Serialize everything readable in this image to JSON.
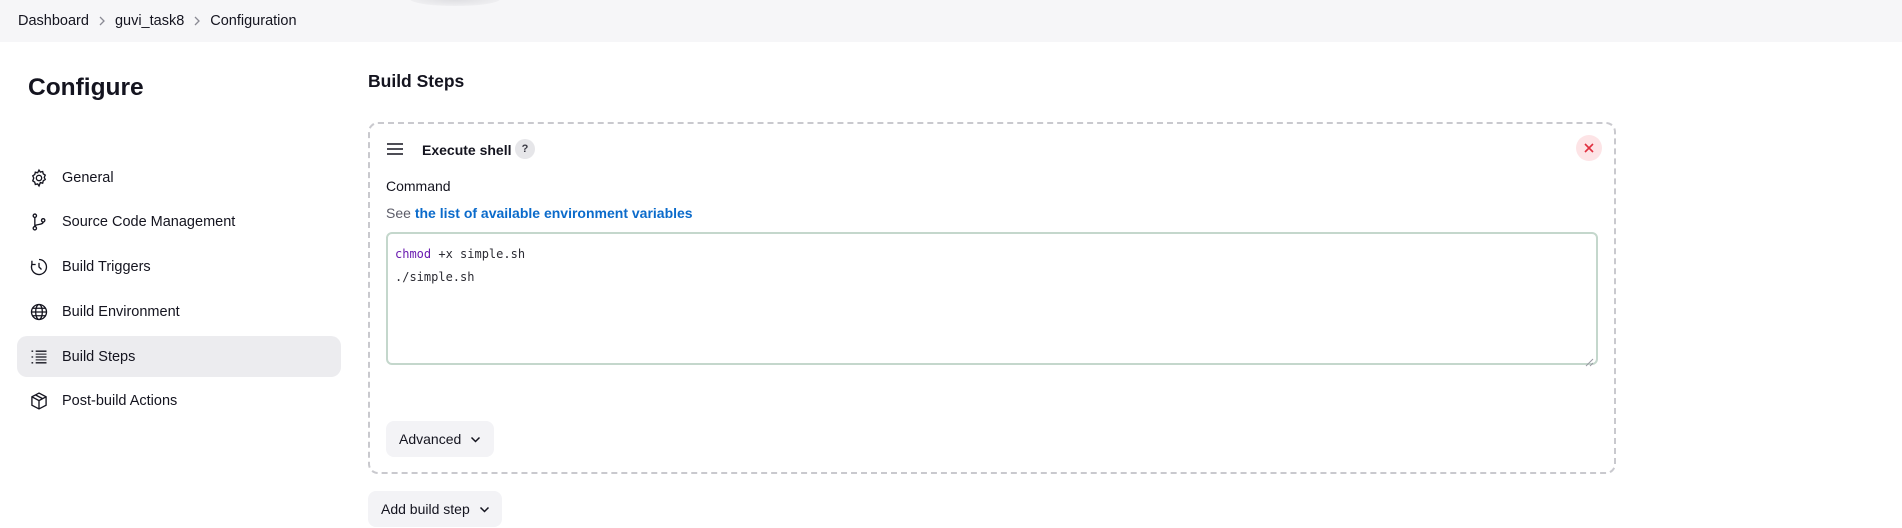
{
  "breadcrumb": {
    "items": [
      "Dashboard",
      "guvi_task8",
      "Configuration"
    ]
  },
  "sidebar": {
    "title": "Configure",
    "items": [
      {
        "label": "General",
        "icon": "gear-icon",
        "active": false
      },
      {
        "label": "Source Code Management",
        "icon": "branch-icon",
        "active": false
      },
      {
        "label": "Build Triggers",
        "icon": "clock-icon",
        "active": false
      },
      {
        "label": "Build Environment",
        "icon": "globe-icon",
        "active": false
      },
      {
        "label": "Build Steps",
        "icon": "list-icon",
        "active": true
      },
      {
        "label": "Post-build Actions",
        "icon": "cube-icon",
        "active": false
      }
    ]
  },
  "main": {
    "section_title": "Build Steps",
    "step": {
      "name": "Execute shell",
      "help": "?",
      "command_label": "Command",
      "env_hint_prefix": "See",
      "env_link": "the list of available environment variables",
      "command_lines": [
        {
          "keyword": "chmod",
          "rest": " +x simple.sh"
        },
        {
          "keyword": "",
          "rest": "./simple.sh"
        }
      ],
      "advanced_label": "Advanced"
    },
    "add_step_label": "Add build step"
  },
  "colors": {
    "link": "#0b6bcb",
    "delete": "#e0303f",
    "keyword": "#6a1bb0",
    "active_bg": "#ececef"
  }
}
